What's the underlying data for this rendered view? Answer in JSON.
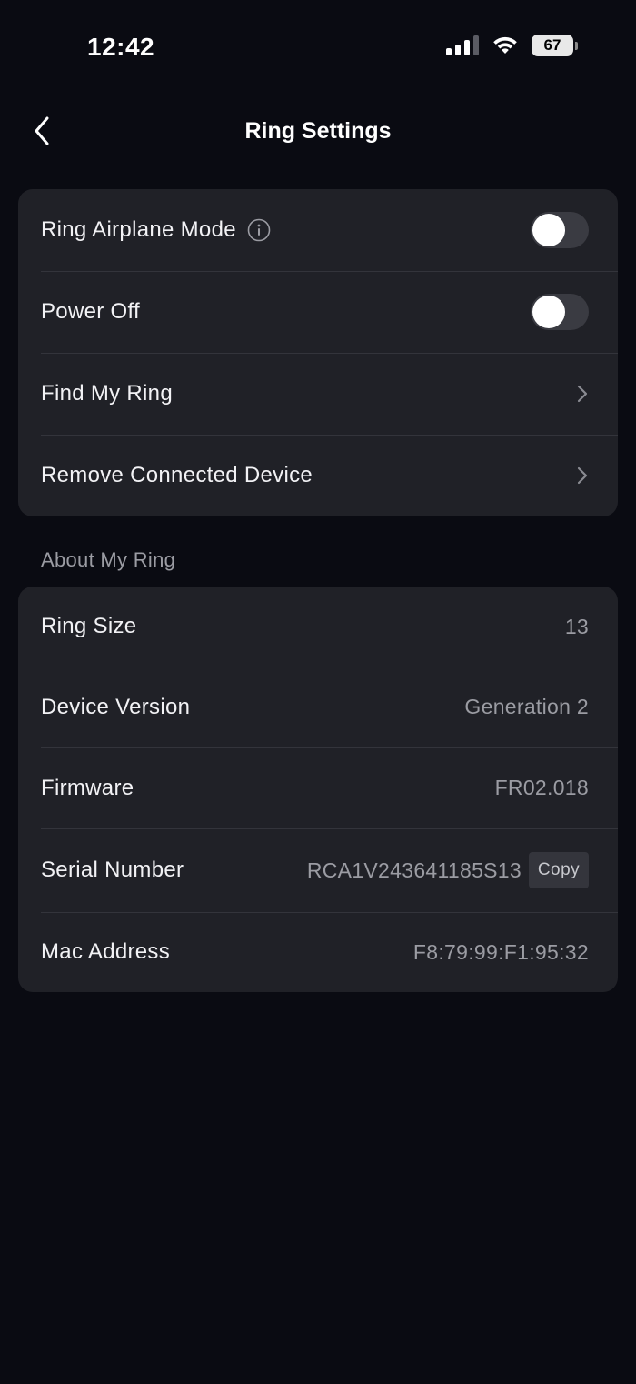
{
  "status_bar": {
    "time": "12:42",
    "battery": "67"
  },
  "nav": {
    "title": "Ring Settings",
    "back_icon": "chevron-left-icon"
  },
  "settings": {
    "airplane_mode": {
      "label": "Ring Airplane Mode",
      "enabled": false
    },
    "power_off": {
      "label": "Power Off",
      "enabled": false
    },
    "find_my_ring": {
      "label": "Find My Ring"
    },
    "remove_connected_device": {
      "label": "Remove Connected Device"
    }
  },
  "about": {
    "header": "About My Ring",
    "ring_size": {
      "label": "Ring Size",
      "value": "13"
    },
    "device_version": {
      "label": "Device Version",
      "value": "Generation 2"
    },
    "firmware": {
      "label": "Firmware",
      "value": "FR02.018"
    },
    "serial_number": {
      "label": "Serial Number",
      "value": "RCA1V243641185S13",
      "copy_label": "Copy"
    },
    "mac_address": {
      "label": "Mac Address",
      "value": "F8:79:99:F1:95:32"
    }
  },
  "colors": {
    "background": "#0a0b12",
    "card": "#202127",
    "toggle_off": "#3a3b42",
    "secondary_text": "#9b9ca3"
  }
}
